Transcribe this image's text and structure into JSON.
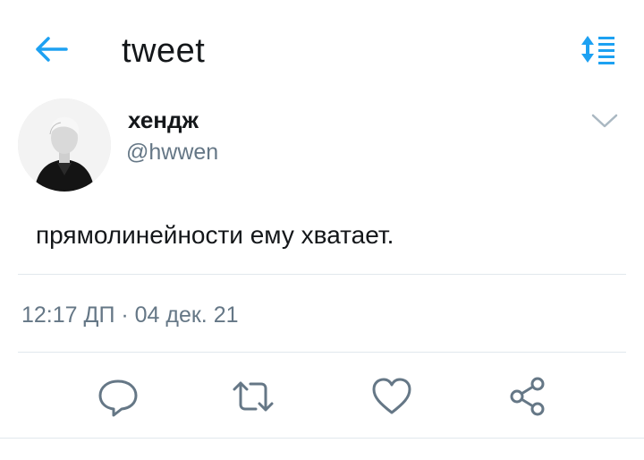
{
  "header": {
    "title": "tweet",
    "back_icon": "arrow-left-icon",
    "sort_icon": "sort-list-icon",
    "accent_color": "#1da1f2"
  },
  "tweet": {
    "author": {
      "display_name": "хендж",
      "handle": "@hwwen",
      "avatar": "profile-photo"
    },
    "text": "прямолинейности ему хватает.",
    "timestamp": "12:17 ДП · 04 дек. 21",
    "menu_icon": "chevron-down-icon"
  },
  "actions": [
    {
      "name": "reply",
      "icon": "comment-icon"
    },
    {
      "name": "retweet",
      "icon": "retweet-icon"
    },
    {
      "name": "like",
      "icon": "heart-icon"
    },
    {
      "name": "share",
      "icon": "share-icon"
    }
  ],
  "colors": {
    "text_primary": "#14171a",
    "text_secondary": "#657786",
    "divider": "#e1e8ed",
    "icon_gray": "#657786"
  }
}
